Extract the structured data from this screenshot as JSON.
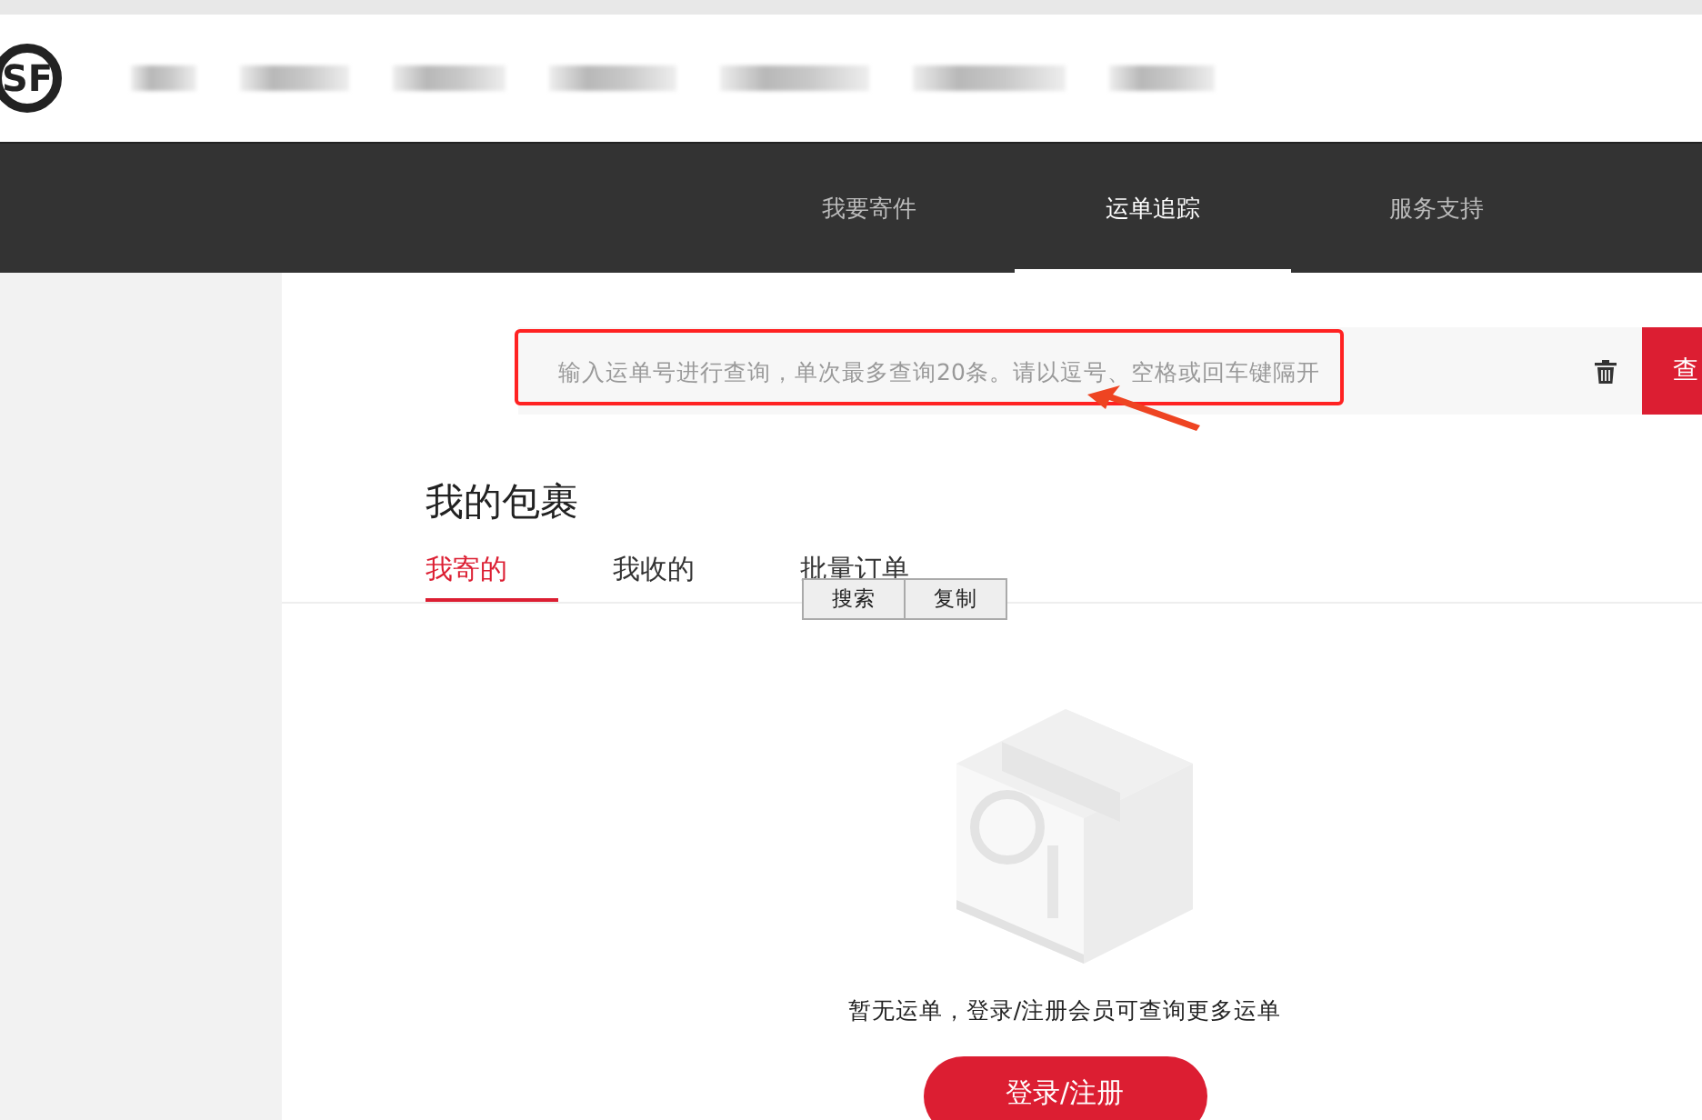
{
  "header": {
    "logo": "SF"
  },
  "nav": {
    "tabs": [
      {
        "label": "我要寄件",
        "selected": false
      },
      {
        "label": "运单追踪",
        "selected": true
      },
      {
        "label": "服务支持",
        "selected": false
      }
    ]
  },
  "search": {
    "placeholder": "输入运单号进行查询，单次最多查询20条。请以逗号、空格或回车键隔开",
    "button": "查"
  },
  "section": {
    "title": "我的包裹",
    "tabs": [
      {
        "label": "我寄的",
        "selected": true
      },
      {
        "label": "我收的",
        "selected": false
      },
      {
        "label": "批量订单",
        "selected": false
      }
    ]
  },
  "context_menu": {
    "items": [
      "搜索",
      "复制"
    ]
  },
  "empty": {
    "kind": "picture",
    "message": "暂无运单，登录/注册会员可查询更多运单",
    "button": "登录/注册"
  }
}
